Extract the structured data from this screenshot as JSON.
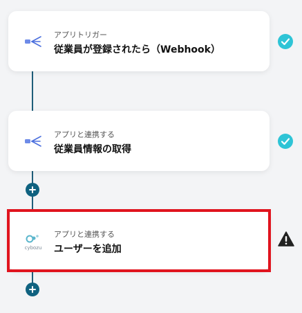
{
  "flow": {
    "steps": [
      {
        "subtitle": "アプリトリガー",
        "title": "従業員が登録されたら（Webhook）",
        "status": "complete",
        "icon": "freee-hr-icon"
      },
      {
        "subtitle": "アプリと連携する",
        "title": "従業員情報の取得",
        "status": "complete",
        "icon": "freee-hr-icon"
      },
      {
        "subtitle": "アプリと連携する",
        "title": "ユーザーを追加",
        "status": "warning",
        "icon": "cybozu-logo",
        "icon_text": "cybozu"
      }
    ]
  },
  "colors": {
    "accent": "#0f6280",
    "check": "#2ec4d6",
    "highlight": "#e0141e"
  }
}
